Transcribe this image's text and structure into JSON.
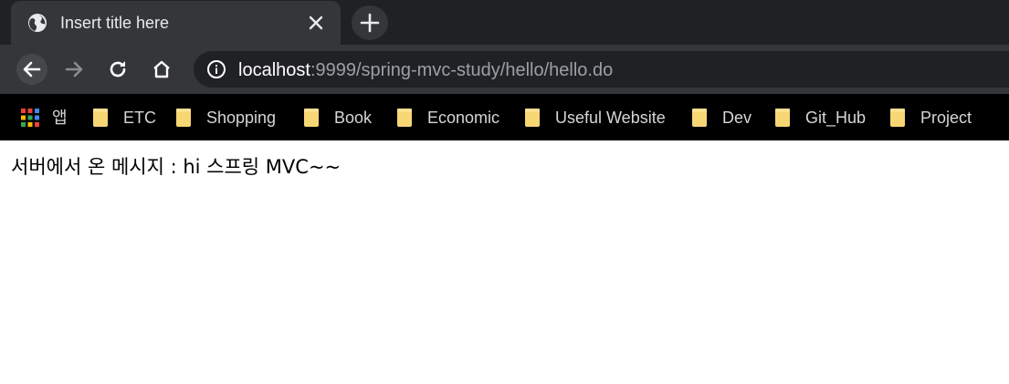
{
  "tab": {
    "title": "Insert title here"
  },
  "omnibox": {
    "host": "localhost",
    "path": ":9999/spring-mvc-study/hello/hello.do"
  },
  "bookmarks": {
    "apps_label": "앱",
    "items": [
      {
        "label": "ETC",
        "icon": "folder-icon"
      },
      {
        "label": "Shopping",
        "icon": "folder-icon"
      },
      {
        "label": "Book",
        "icon": "folder-icon"
      },
      {
        "label": "Economic",
        "icon": "folder-icon"
      },
      {
        "label": "Useful Website",
        "icon": "folder-icon"
      },
      {
        "label": "Dev",
        "icon": "folder-icon"
      },
      {
        "label": "Git_Hub",
        "icon": "folder-icon"
      },
      {
        "label": "Project",
        "icon": "folder-icon"
      }
    ]
  },
  "page": {
    "message": "서버에서 온 메시지 : hi 스프링 MVC~~"
  },
  "colors": {
    "tabstrip": "#202124",
    "toolbar": "#35363a",
    "omnibox": "#202124",
    "bookmarks_bar": "#000000",
    "folder": "#f7d774"
  }
}
